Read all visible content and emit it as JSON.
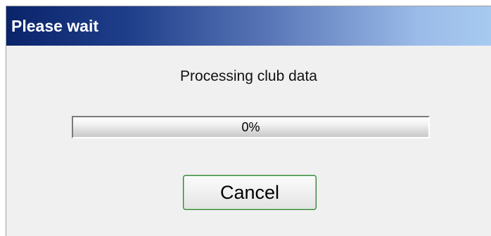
{
  "window": {
    "title": "Please wait"
  },
  "dialog": {
    "message": "Processing club data",
    "progress": {
      "value_percent": 0,
      "label": "0%"
    },
    "cancel_label": "Cancel"
  },
  "colors": {
    "titlebar_start": "#0a246a",
    "titlebar_end": "#a6caf0",
    "button_border": "#2e7d32"
  }
}
